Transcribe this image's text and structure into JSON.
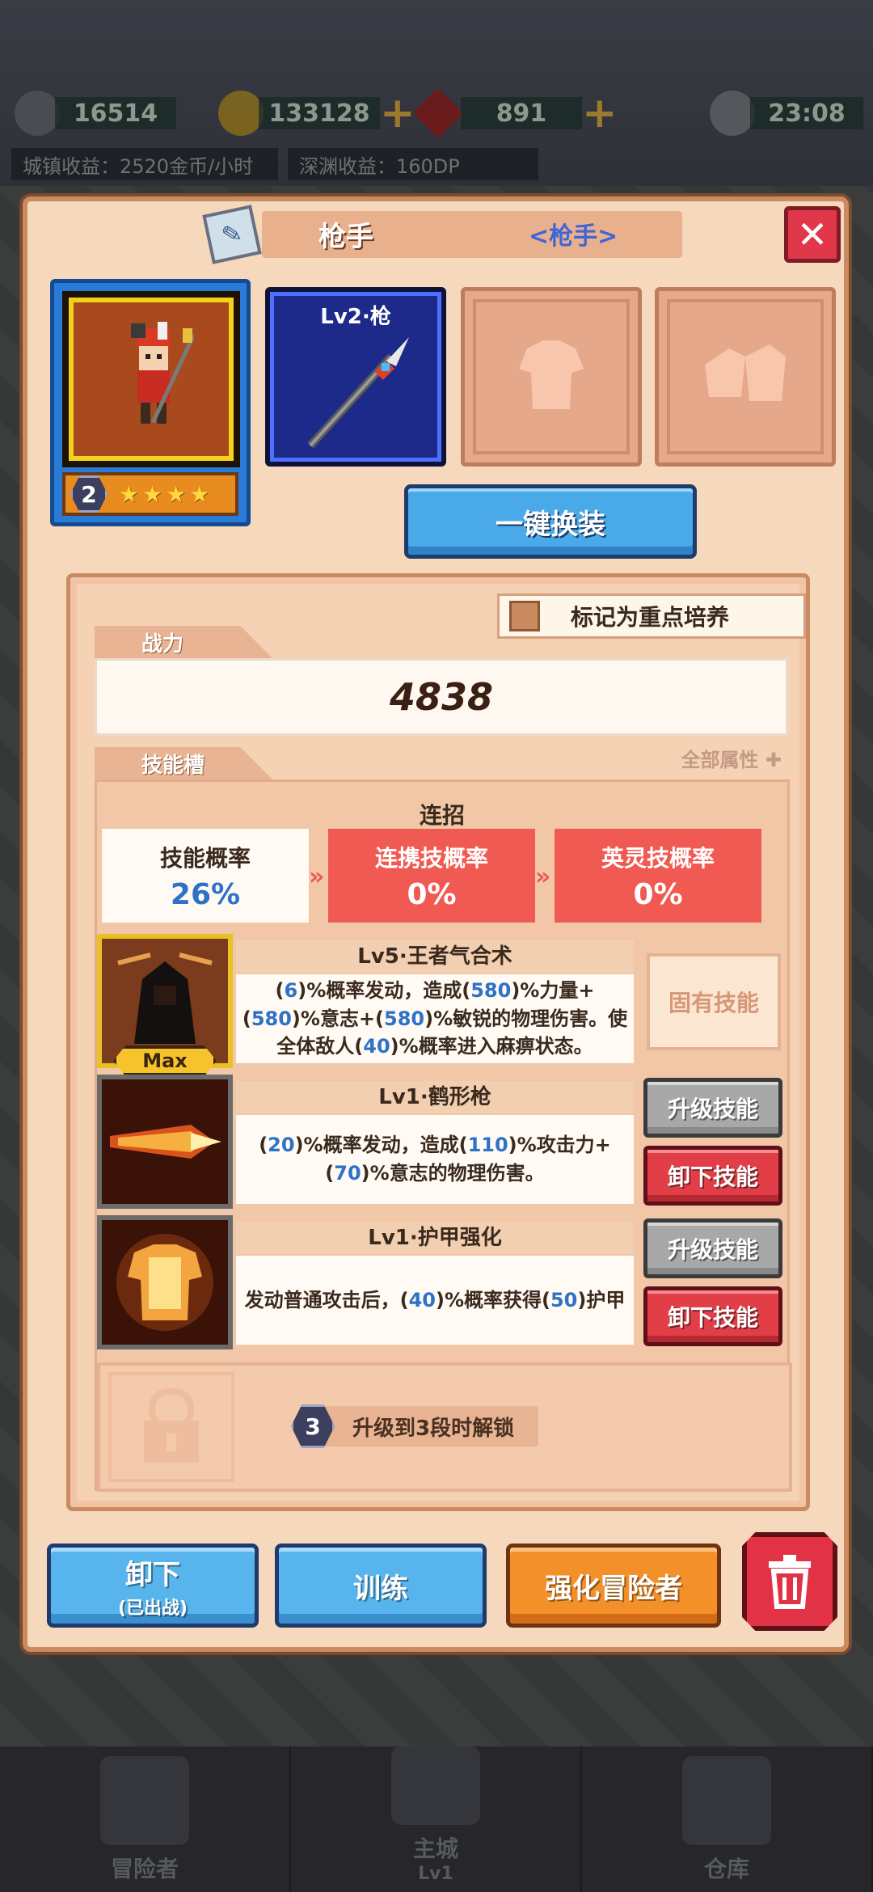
{
  "top_bar": {
    "resource1": "16514",
    "resource2": "133128",
    "resource3": "891",
    "clock": "23:08",
    "town_income": "城镇收益：2520金币/小时",
    "abyss_income": "深渊收益：160DP"
  },
  "bottom_nav": {
    "adventurer": "冒险者",
    "main_city": "主城",
    "main_city_level": "Lv1",
    "warehouse": "仓库"
  },
  "dialog": {
    "title": "枪手",
    "class_tag": "<枪手>",
    "hero_rank": "2",
    "hero_stars": 4,
    "weapon_label": "Lv2·枪",
    "equip_all_button": "一键换装",
    "mark_focus_label": "标记为重点培养",
    "power_tab": "战力",
    "power_value": "4838",
    "skills_tab": "技能槽",
    "all_attributes": "全部属性",
    "combo": {
      "heading": "连招",
      "boxes": [
        {
          "label": "技能概率",
          "value": "26%"
        },
        {
          "label": "连携技概率",
          "value": "0%"
        },
        {
          "label": "英灵技概率",
          "value": "0%"
        }
      ]
    },
    "skills": [
      {
        "title": "Lv5·王者气合术",
        "desc_parts": [
          "(",
          "6",
          ")%概率发动，造成(",
          "580",
          ")%力量+(",
          "580",
          ")%意志+(",
          "580",
          ")%敏锐的物理伤害。使全体敌人(",
          "40",
          ")%概率进入麻痹状态。"
        ],
        "badge": "Max",
        "innate_label": "固有技能"
      },
      {
        "title": "Lv1·鹤形枪",
        "desc_parts": [
          "(",
          "20",
          ")%概率发动，造成(",
          "110",
          ")%攻击力+(",
          "70",
          ")%意志的物理伤害。"
        ],
        "upgrade_label": "升级技能",
        "remove_label": "卸下技能"
      },
      {
        "title": "Lv1·护甲强化",
        "desc_parts": [
          "发动普通攻击后，(",
          "40",
          ")%概率获得(",
          "50",
          ")护甲"
        ],
        "upgrade_label": "升级技能",
        "remove_label": "卸下技能"
      }
    ],
    "locked_slot": {
      "rank": "3",
      "text": "升级到3段时解锁"
    },
    "buttons": {
      "unequip": "卸下",
      "unequip_sub": "(已出战)",
      "train": "训练",
      "enhance": "强化冒险者"
    }
  },
  "colors": {
    "panel": "#f6d8bd",
    "accent_blue": "#2e72c8",
    "accent_red": "#f05a52",
    "button_blue": "#58b4ec",
    "button_orange": "#f4902a"
  }
}
